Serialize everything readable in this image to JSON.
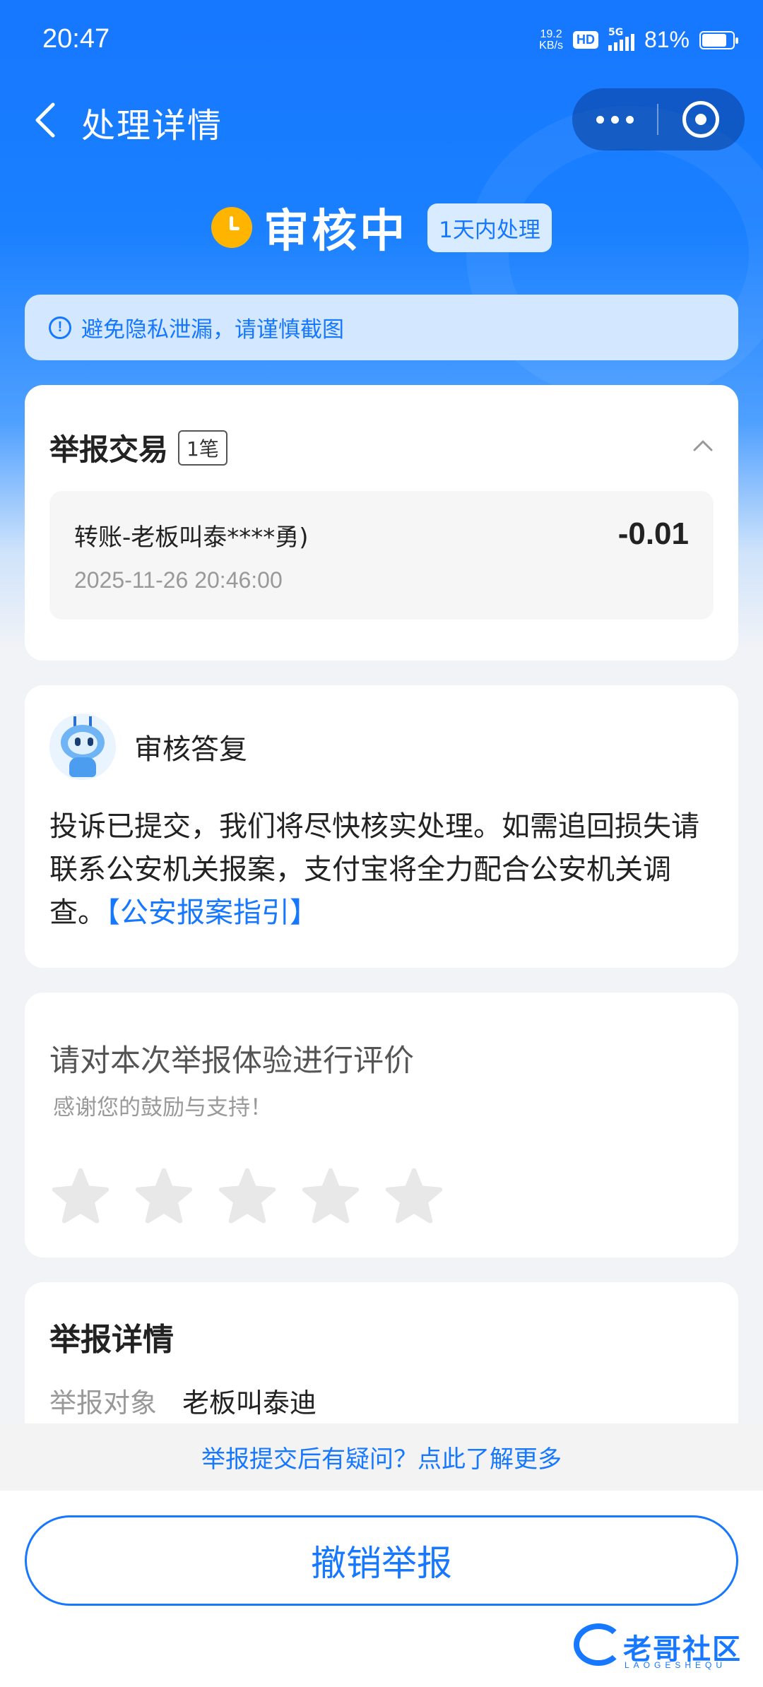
{
  "status_bar": {
    "time": "20:47",
    "net_speed_value": "19.2",
    "net_speed_unit": "KB/s",
    "hd": "HD",
    "network": "5G",
    "battery": "81%",
    "battery_level": 0.81
  },
  "nav": {
    "title": "处理详情"
  },
  "status": {
    "text": "审核中",
    "badge": "1天内处理",
    "icon": "clock-icon"
  },
  "notice": {
    "icon": "info-icon",
    "text": "避免隐私泄漏，请谨慎截图"
  },
  "transaction_card": {
    "title": "举报交易",
    "count": "1笔",
    "item": {
      "name": "转账-老板叫泰****勇)",
      "amount": "-0.01",
      "time": "2025-11-26 20:46:00"
    }
  },
  "reply_card": {
    "title": "审核答复",
    "body": "投诉已提交，我们将尽快核实处理。如需追回损失请联系公安机关报案，支付宝将全力配合公安机关调查。",
    "link": "【公安报案指引】"
  },
  "rating_card": {
    "title": "请对本次举报体验进行评价",
    "subtitle": "感谢您的鼓励与支持！",
    "rating": 0,
    "max_rating": 5
  },
  "detail_card": {
    "title": "举报详情",
    "rows": [
      {
        "label": "举报对象",
        "value": "老板叫泰迪"
      }
    ]
  },
  "bottom": {
    "help_link": "举报提交后有疑问？点此了解更多",
    "cancel_button": "撤销举报"
  },
  "watermark": {
    "text": "老哥社区",
    "sub": "LAOGESHEQU"
  },
  "colors": {
    "primary": "#1677ff",
    "status_icon": "#ffb400",
    "notice_bg": "#d3e8ff"
  }
}
